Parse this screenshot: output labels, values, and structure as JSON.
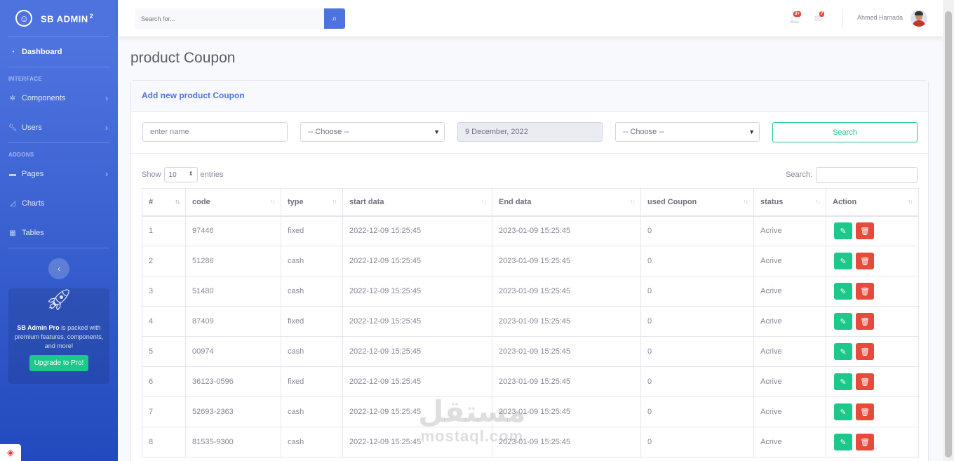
{
  "sidebar": {
    "brand": "SB ADMIN",
    "brand_sup": "2",
    "dashboard": "Dashboard",
    "heading_interface": "INTERFACE",
    "components": "Components",
    "users": "Users",
    "heading_addons": "ADDONS",
    "pages": "Pages",
    "charts": "Charts",
    "tables": "Tables",
    "promo_bold": "SB Admin Pro",
    "promo_text": " is packed with premium features, components, and more!",
    "promo_button": "Upgrade to Pro!"
  },
  "topbar": {
    "search_placeholder": "Search for...",
    "alerts_count": "3+",
    "messages_count": "7",
    "user_name": "Ahmed Hamada"
  },
  "page": {
    "title": "product Coupon"
  },
  "card": {
    "header": "Add new product Coupon",
    "filters": {
      "name_placeholder": "enter name",
      "choose_1": "-- Choose --",
      "date": "9 December, 2022",
      "choose_2": "-- Choose --",
      "search_button": "Search"
    },
    "datatable": {
      "show": "Show",
      "length": "10",
      "entries": "entries",
      "search_label": "Search:"
    },
    "columns": [
      "#",
      "code",
      "type",
      "start data",
      "End data",
      "used Coupon",
      "status",
      "Action"
    ],
    "rows": [
      [
        "1",
        "97446",
        "fixed",
        "2022-12-09 15:25:45",
        "2023-01-09 15:25:45",
        "0",
        "Acrive"
      ],
      [
        "2",
        "51286",
        "cash",
        "2022-12-09 15:25:45",
        "2023-01-09 15:25:45",
        "0",
        "Acrive"
      ],
      [
        "3",
        "51480",
        "cash",
        "2022-12-09 15:25:45",
        "2023-01-09 15:25:45",
        "0",
        "Acrive"
      ],
      [
        "4",
        "87409",
        "fixed",
        "2022-12-09 15:25:45",
        "2023-01-09 15:25:45",
        "0",
        "Acrive"
      ],
      [
        "5",
        "00974",
        "cash",
        "2022-12-09 15:25:45",
        "2023-01-09 15:25:45",
        "0",
        "Acrive"
      ],
      [
        "6",
        "36123-0596",
        "fixed",
        "2022-12-09 15:25:45",
        "2023-01-09 15:25:45",
        "0",
        "Acrive"
      ],
      [
        "7",
        "52693-2363",
        "cash",
        "2022-12-09 15:25:45",
        "2023-01-09 15:25:45",
        "0",
        "Acrive"
      ],
      [
        "8",
        "81535-9300",
        "cash",
        "2022-12-09 15:25:45",
        "2023-01-09 15:25:45",
        "0",
        "Acrive"
      ]
    ]
  },
  "watermark": {
    "arabic": "مستقل",
    "latin": "mostaql.com"
  },
  "colors": {
    "primary": "#4e73df",
    "success": "#1cc88a",
    "danger": "#e74a3b"
  }
}
